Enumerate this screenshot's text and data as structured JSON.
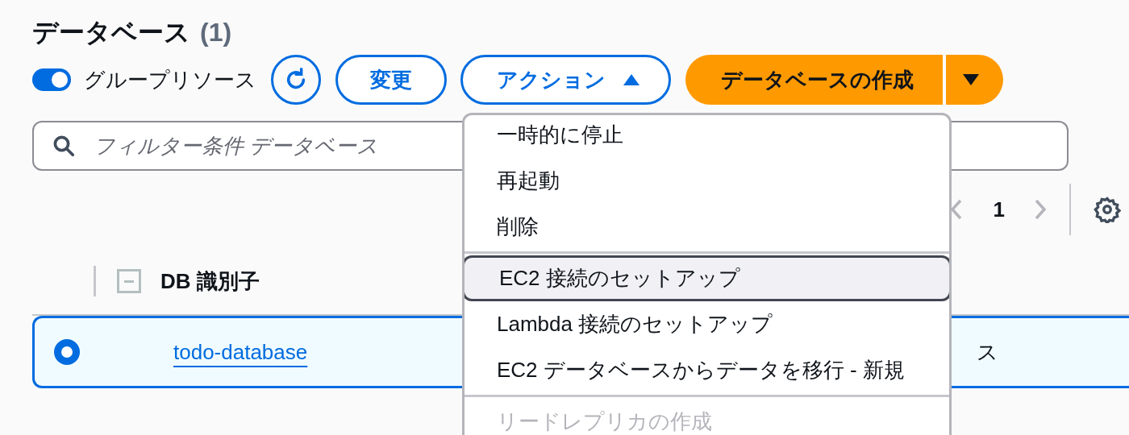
{
  "header": {
    "title": "データベース",
    "count": "(1)"
  },
  "toolbar": {
    "group_resources": {
      "label": "グループリソース",
      "on": true
    },
    "modify_button": "変更",
    "actions_button": {
      "label": "アクション",
      "expanded": true
    },
    "create_button": "データベースの作成"
  },
  "search": {
    "placeholder": "フィルター条件 データベース"
  },
  "pagination": {
    "page": "1"
  },
  "table": {
    "select_all": {
      "indeterminate": true
    },
    "columns": [
      {
        "label": "DB 識別子"
      }
    ],
    "rows": [
      {
        "selected": true,
        "db_identifier": "todo-database",
        "column_3": "ス"
      }
    ]
  },
  "actions_menu": {
    "groups": [
      {
        "items": [
          {
            "label": "一時的に停止",
            "focused": false,
            "disabled": false
          },
          {
            "label": "再起動",
            "focused": false,
            "disabled": false
          },
          {
            "label": "削除",
            "focused": false,
            "disabled": false
          }
        ]
      },
      {
        "items": [
          {
            "label": "EC2 接続のセットアップ",
            "focused": true,
            "disabled": false
          },
          {
            "label": "Lambda 接続のセットアップ",
            "focused": false,
            "disabled": false
          },
          {
            "label": "EC2 データベースからデータを移行 - 新規",
            "focused": false,
            "disabled": false
          }
        ]
      },
      {
        "items": [
          {
            "label": "リードレプリカの作成",
            "focused": false,
            "disabled": true
          }
        ]
      }
    ]
  }
}
